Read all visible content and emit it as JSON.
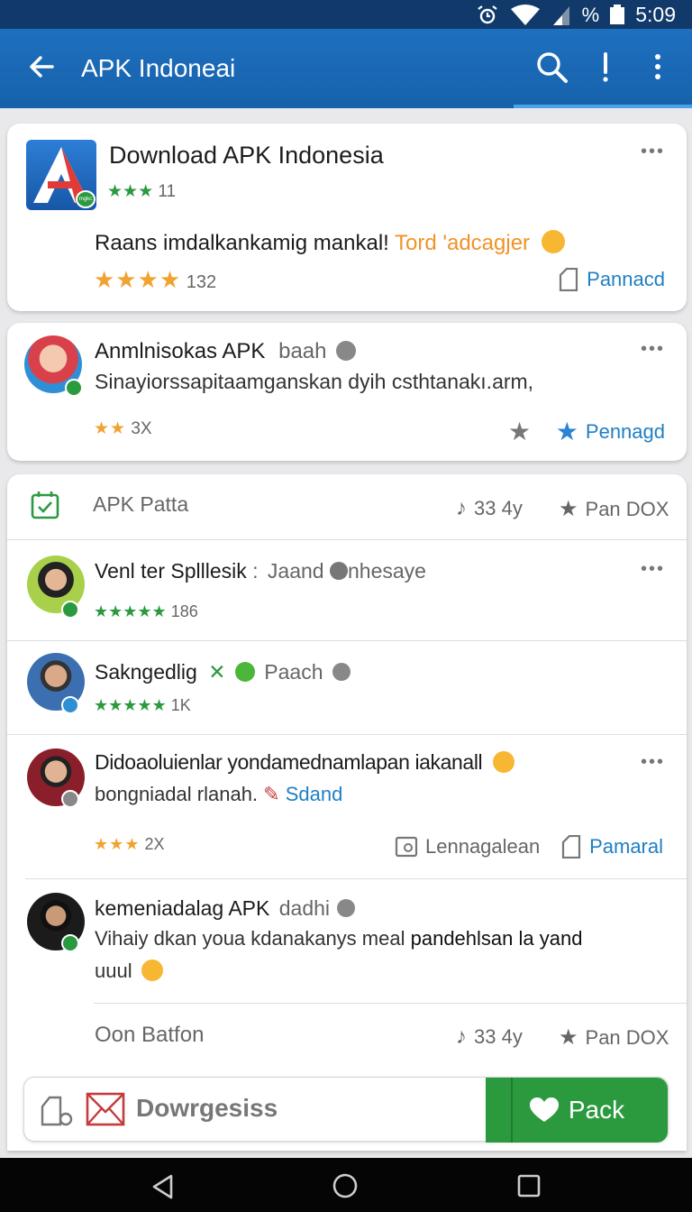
{
  "status_bar": {
    "time": "5:09",
    "battery_text": "%"
  },
  "app_bar": {
    "title": "APK Indoneai"
  },
  "card1": {
    "title": "Download APK Indonesia",
    "app_rating_count": "11",
    "app_badge": "mgkc",
    "text_main": "Raans imdalkankamig mankal!",
    "text_accent": "Tord 'adcagjer",
    "rating_count": "132",
    "action_label": "Pannacd"
  },
  "card2": {
    "title": "Anmlnisokas APK",
    "title_tag": "baah",
    "subtitle": "Sinayiorssapitaamganskan dyih csthtanakı.arm,",
    "rating_count": "3X",
    "action_label": "Pennagd"
  },
  "card3": {
    "header_label": "APK Patta",
    "header_stat": "33 4y",
    "header_action": "Pan DOX",
    "items": [
      {
        "name": "Venl ter Splllesik",
        "sep": ":",
        "tag": "Jaand",
        "tag2": "nhesaye",
        "rating_count": "186"
      },
      {
        "name": "Sakngedlig",
        "tag": "Paach",
        "rating_count": "1K"
      },
      {
        "name": "Didoaoluienlar yondamednamlapan iakanall",
        "line2": "bongniadal rlanah.",
        "line2_link": "Sdand",
        "rating_count": "2X",
        "action1": "Lennagalean",
        "action2": "Pamaral"
      },
      {
        "name": "kemeniadalag APK",
        "tag": "dadhi",
        "body": "Vihaiy dkan youa kdanakanys meal",
        "body_bold": "pandehlsan la yand",
        "body2": "uuul"
      }
    ],
    "footer_label": "Oon Batfon",
    "footer_stat": "33 4y",
    "footer_action": "Pan DOX"
  },
  "composer": {
    "placeholder": "Dowrgesiss",
    "send_label": "Pack"
  },
  "colors": {
    "app_bar": "#1d70bf",
    "status_bar": "#113a6b",
    "accent_green": "#2b9a3f",
    "link_blue": "#1f7fc4",
    "star_orange": "#f0a330"
  }
}
